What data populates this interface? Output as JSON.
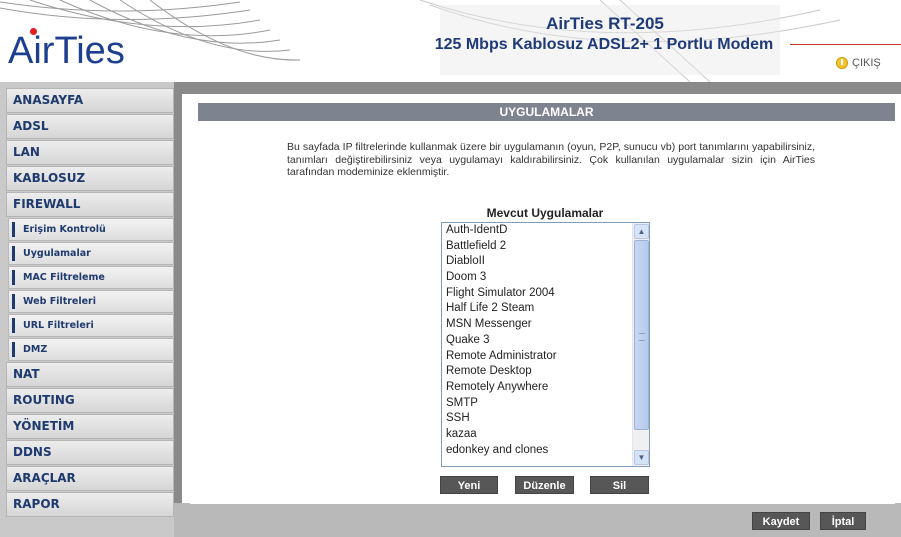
{
  "header": {
    "logo_text": "AirTies",
    "model_title": "AirTies RT-205",
    "model_subtitle": "125 Mbps Kablosuz ADSL2+ 1 Portlu Modem",
    "logout_label": "ÇIKIŞ",
    "logout_icon": "power-icon",
    "brand_color": "#1e3a78",
    "accent_color": "#e31b23"
  },
  "sidebar": {
    "items_top": [
      {
        "label": "ANASAYFA"
      },
      {
        "label": "ADSL"
      },
      {
        "label": "LAN"
      },
      {
        "label": "KABLOSUZ"
      },
      {
        "label": "FIREWALL"
      }
    ],
    "firewall_sub": [
      {
        "label": "Erişim Kontrolü"
      },
      {
        "label": "Uygulamalar"
      },
      {
        "label": "MAC Filtreleme"
      },
      {
        "label": "Web Filtreleri"
      },
      {
        "label": "URL Filtreleri"
      },
      {
        "label": "DMZ"
      }
    ],
    "items_bottom": [
      {
        "label": "NAT"
      },
      {
        "label": "ROUTING"
      },
      {
        "label": "YÖNETİM"
      },
      {
        "label": "DDNS"
      },
      {
        "label": "ARAÇLAR"
      },
      {
        "label": "RAPOR"
      }
    ]
  },
  "main": {
    "section_title": "UYGULAMALAR",
    "description": "Bu sayfada IP filtrelerinde kullanmak üzere bir uygulamanın (oyun, P2P, sunucu vb) port tanımlarını yapabilirsiniz, tanımları değiştirebilirsiniz veya uygulamayı kaldırabilirsiniz. Çok kullanılan uygulamalar sizin için AirTies tarafından modeminize eklenmiştir.",
    "list_label": "Mevcut Uygulamalar",
    "applications": [
      "Auth-IdentD",
      "Battlefield 2",
      "DiabloII",
      "Doom 3",
      "Flight Simulator 2004",
      "Half Life 2 Steam",
      "MSN Messenger",
      "Quake 3",
      "Remote Administrator",
      "Remote Desktop",
      "Remotely Anywhere",
      "SMTP",
      "SSH",
      "kazaa",
      "edonkey and clones"
    ],
    "buttons": {
      "new": "Yeni",
      "edit": "Düzenle",
      "delete": "Sil"
    }
  },
  "footer": {
    "save": "Kaydet",
    "cancel": "İptal"
  }
}
